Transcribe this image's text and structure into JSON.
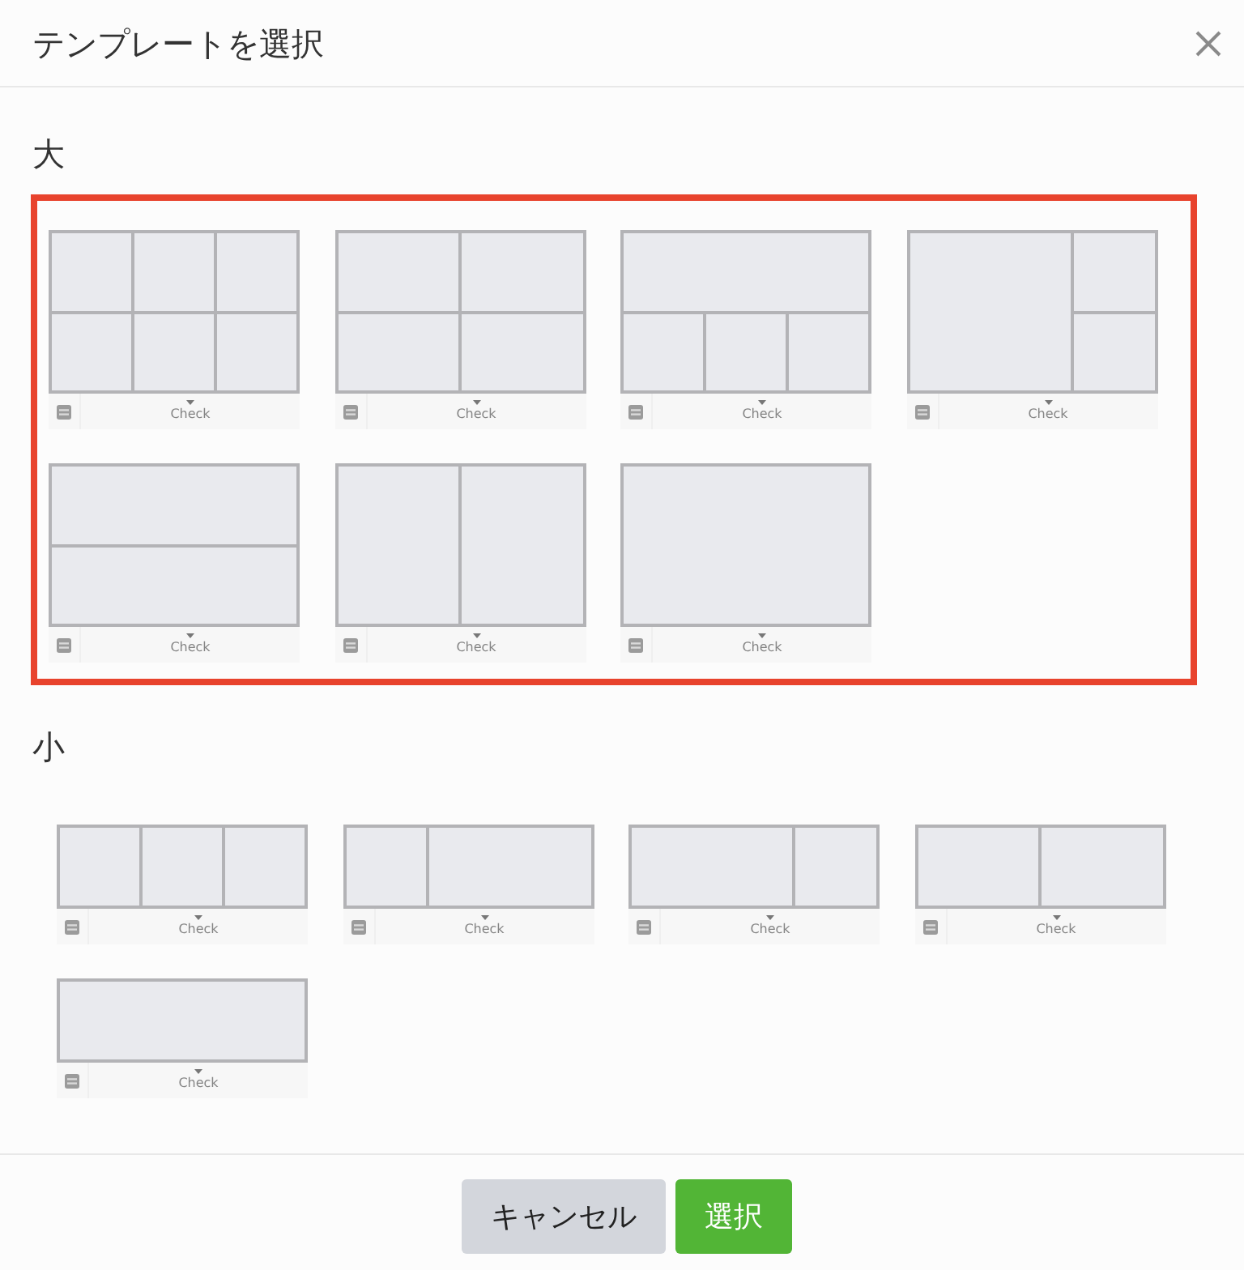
{
  "dialog": {
    "title": "テンプレートを選択"
  },
  "sections": [
    {
      "label": "大",
      "kind": "large",
      "highlighted": true,
      "templates": [
        {
          "kind": "grid6",
          "caption": "Check"
        },
        {
          "kind": "grid4",
          "caption": "Check"
        },
        {
          "kind": "top1bottom3",
          "caption": "Check"
        },
        {
          "kind": "left1right2",
          "caption": "Check"
        },
        {
          "kind": "rows2",
          "caption": "Check"
        },
        {
          "kind": "cols2",
          "caption": "Check"
        },
        {
          "kind": "single",
          "caption": "Check"
        }
      ]
    },
    {
      "label": "小",
      "kind": "small",
      "highlighted": false,
      "templates": [
        {
          "kind": "cols3",
          "caption": "Check"
        },
        {
          "kind": "narrowwide",
          "caption": "Check"
        },
        {
          "kind": "widenarrow",
          "caption": "Check"
        },
        {
          "kind": "cols2",
          "caption": "Check"
        },
        {
          "kind": "single",
          "caption": "Check"
        }
      ]
    }
  ],
  "buttons": [
    {
      "label": "キャンセル",
      "kind": "secondary"
    },
    {
      "label": "選択",
      "kind": "primary"
    }
  ]
}
